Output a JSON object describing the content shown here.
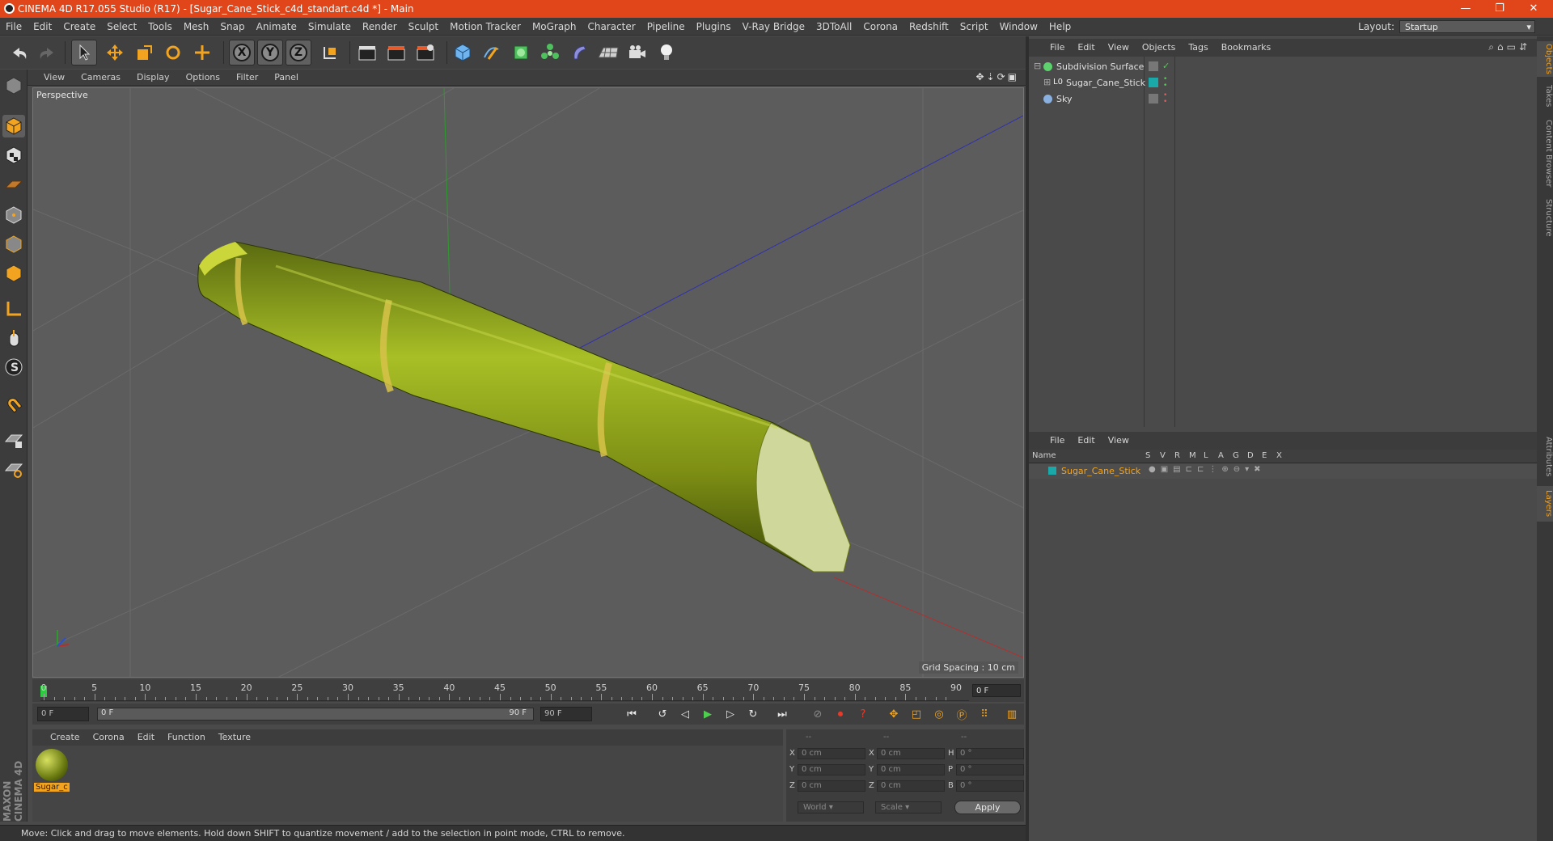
{
  "window": {
    "title": "CINEMA 4D R17.055 Studio (R17) - [Sugar_Cane_Stick_c4d_standart.c4d *] - Main",
    "controls": [
      "—",
      "❐",
      "✕"
    ]
  },
  "menubar": {
    "items": [
      "File",
      "Edit",
      "Create",
      "Select",
      "Tools",
      "Mesh",
      "Snap",
      "Animate",
      "Simulate",
      "Render",
      "Sculpt",
      "Motion Tracker",
      "MoGraph",
      "Character",
      "Pipeline",
      "Plugins",
      "V-Ray Bridge",
      "3DToAll",
      "Corona",
      "Redshift",
      "Script",
      "Window",
      "Help"
    ],
    "layout_label": "Layout:",
    "layout_value": "Startup"
  },
  "viewport": {
    "menu": [
      "View",
      "Cameras",
      "Display",
      "Options",
      "Filter",
      "Panel"
    ],
    "label": "Perspective",
    "grid_spacing": "Grid Spacing : 10 cm"
  },
  "timeline": {
    "ticks": [
      "0",
      "5",
      "10",
      "15",
      "20",
      "25",
      "30",
      "35",
      "40",
      "45",
      "50",
      "55",
      "60",
      "65",
      "70",
      "75",
      "80",
      "85",
      "90"
    ],
    "current_frame": "0 F",
    "start_field": "0 F",
    "range_start": "0 F",
    "range_end": "90 F",
    "end_field": "90 F"
  },
  "materials": {
    "menu": [
      "Create",
      "Corona",
      "Edit",
      "Function",
      "Texture"
    ],
    "items": [
      {
        "name": "Sugar_c"
      }
    ],
    "logo": "MAXON CINEMA 4D"
  },
  "coordinates": {
    "headers": [
      "--",
      "--",
      "--"
    ],
    "rows": [
      {
        "a": "X",
        "av": "0 cm",
        "b": "X",
        "bv": "0 cm",
        "c": "H",
        "cv": "0 °"
      },
      {
        "a": "Y",
        "av": "0 cm",
        "b": "Y",
        "bv": "0 cm",
        "c": "P",
        "cv": "0 °"
      },
      {
        "a": "Z",
        "av": "0 cm",
        "b": "Z",
        "bv": "0 cm",
        "c": "B",
        "cv": "0 °"
      }
    ],
    "world": "World",
    "scale": "Scale",
    "apply": "Apply"
  },
  "status": "Move: Click and drag to move elements. Hold down SHIFT to quantize movement / add to the selection in point mode, CTRL to remove.",
  "object_manager": {
    "menu": [
      "File",
      "Edit",
      "View",
      "Objects",
      "Tags",
      "Bookmarks"
    ],
    "objects": [
      {
        "name": "Subdivision Surface",
        "icon_color": "#5ed06e"
      },
      {
        "name": "Sugar_Cane_Stick",
        "icon_color": "#e8e8e8"
      },
      {
        "name": "Sky",
        "icon_color": "#8ab0e0"
      }
    ]
  },
  "layer_manager": {
    "menu": [
      "File",
      "Edit",
      "View"
    ],
    "columns": [
      "Name",
      "S",
      "V",
      "R",
      "M",
      "L",
      "A",
      "G",
      "D",
      "E",
      "X"
    ],
    "layers": [
      {
        "name": "Sugar_Cane_Stick",
        "color": "#1aa8a8"
      }
    ]
  },
  "side_tabs": [
    "Objects",
    "Takes",
    "Content Browser",
    "Structure",
    "Attributes",
    "Layers"
  ]
}
